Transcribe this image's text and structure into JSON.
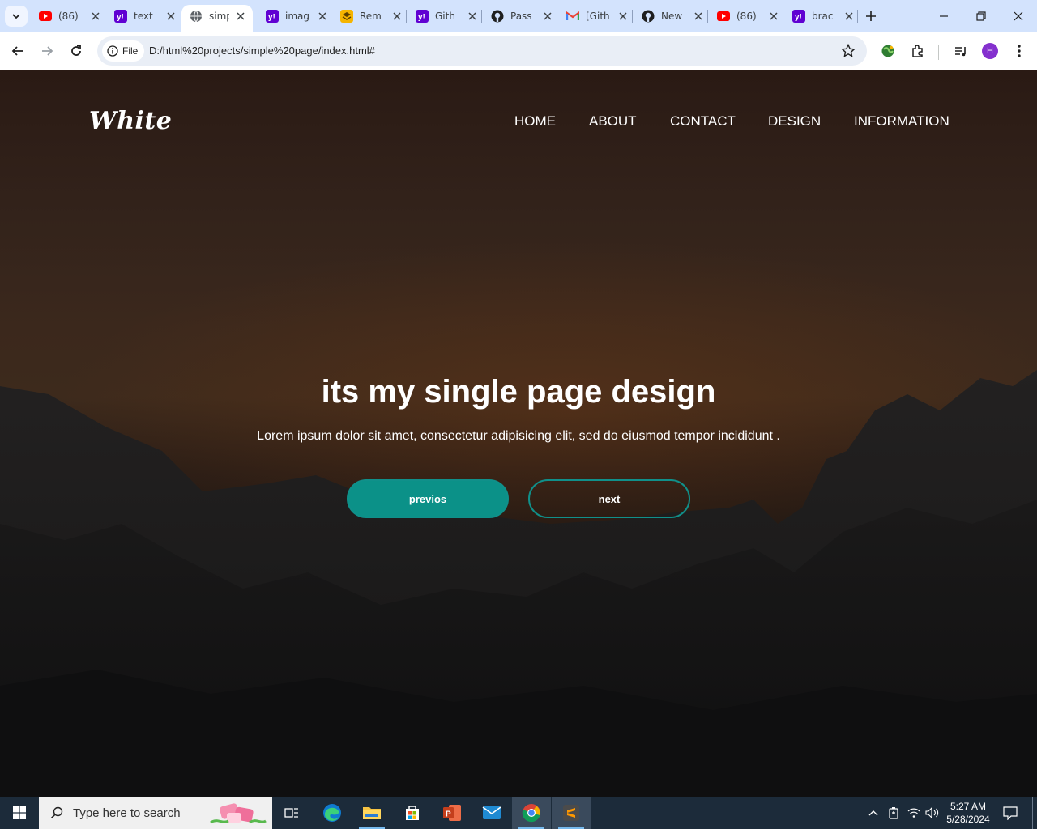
{
  "browser": {
    "tabs": [
      {
        "title": "(86)",
        "icon": "youtube-icon"
      },
      {
        "title": "text",
        "icon": "yahoo-icon"
      },
      {
        "title": "simp",
        "icon": "globe-icon",
        "active": true
      },
      {
        "title": "imag",
        "icon": "yahoo-icon"
      },
      {
        "title": "Rem",
        "icon": "stack-icon"
      },
      {
        "title": "Gith",
        "icon": "yahoo-icon"
      },
      {
        "title": "Pass",
        "icon": "github-icon"
      },
      {
        "title": "[Gith",
        "icon": "gmail-icon"
      },
      {
        "title": "New",
        "icon": "github-icon"
      },
      {
        "title": "(86)",
        "icon": "youtube-icon"
      },
      {
        "title": "brac",
        "icon": "yahoo-icon"
      }
    ],
    "address": {
      "chip_label": "File",
      "url": "D:/html%20projects/simple%20page/index.html#"
    },
    "profile_initial": "H"
  },
  "page": {
    "logo": "White",
    "nav": [
      "HOME",
      "ABOUT",
      "CONTACT",
      "DESIGN",
      "INFORMATION"
    ],
    "hero": {
      "title": "its my single page design",
      "text": "Lorem ipsum dolor sit amet, consectetur adipisicing elit, sed do eiusmod tempor incididunt .",
      "prev_label": "previos",
      "next_label": "next"
    },
    "colors": {
      "accent": "#0b9188"
    }
  },
  "taskbar": {
    "search_placeholder": "Type here to search",
    "time": "5:27 AM",
    "date": "5/28/2024"
  }
}
